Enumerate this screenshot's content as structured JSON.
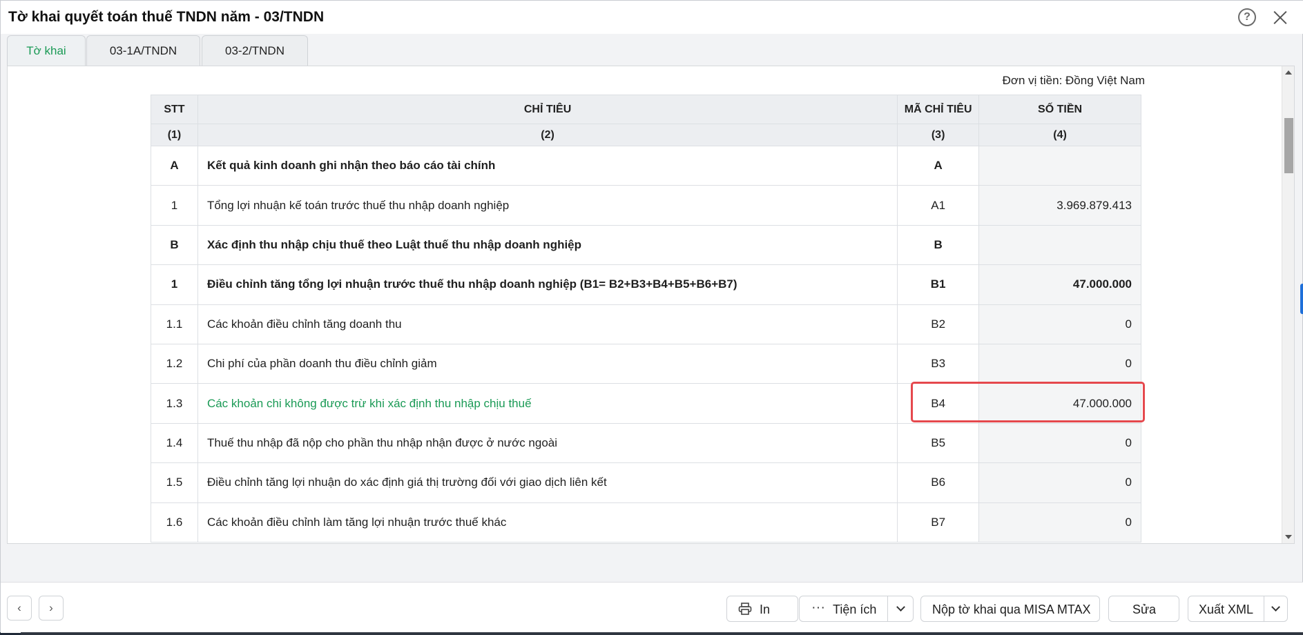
{
  "dialog": {
    "title": "Tờ khai quyết toán thuế TNDN năm - 03/TNDN",
    "help_glyph": "?"
  },
  "tabs": [
    {
      "label": "Tờ khai",
      "active": true
    },
    {
      "label": "03-1A/TNDN",
      "active": false
    },
    {
      "label": "03-2/TNDN",
      "active": false
    }
  ],
  "unit_label": "Đơn vị tiền: Đồng Việt Nam",
  "table": {
    "headers": [
      "STT",
      "CHỈ TIÊU",
      "MÃ CHỈ TIÊU",
      "SỐ TIỀN"
    ],
    "subheaders": [
      "(1)",
      "(2)",
      "(3)",
      "(4)"
    ],
    "rows": [
      {
        "stt": "A",
        "name": "Kết quả kinh doanh ghi nhận theo báo cáo tài chính",
        "code": "A",
        "amount": "",
        "bold": true
      },
      {
        "stt": "1",
        "name": "Tổng lợi nhuận kế toán trước thuế thu nhập doanh nghiệp",
        "code": "A1",
        "amount": "3.969.879.413"
      },
      {
        "stt": "B",
        "name": "Xác định thu nhập chịu thuế theo Luật thuế thu nhập doanh nghiệp",
        "code": "B",
        "amount": "",
        "bold": true
      },
      {
        "stt": "1",
        "name": "Điều chỉnh tăng tổng lợi nhuận trước thuế thu nhập doanh nghiệp  (B1= B2+B3+B4+B5+B6+B7)",
        "code": "B1",
        "amount": "47.000.000",
        "bold": true
      },
      {
        "stt": "1.1",
        "name": "Các khoản điều chỉnh tăng doanh thu",
        "code": "B2",
        "amount": "0"
      },
      {
        "stt": "1.2",
        "name": "Chi phí của phần doanh thu điều chỉnh giảm",
        "code": "B3",
        "amount": "0"
      },
      {
        "stt": "1.3",
        "name": "Các khoản chi không được trừ khi xác định thu nhập chịu thuế",
        "code": "B4",
        "amount": "47.000.000",
        "green": true
      },
      {
        "stt": "1.4",
        "name": "Thuế thu nhập đã nộp cho phần thu nhập nhận được ở nước ngoài",
        "code": "B5",
        "amount": "0"
      },
      {
        "stt": "1.5",
        "name": "Điều chỉnh tăng lợi nhuận do xác định giá thị trường đối với giao dịch liên kết",
        "code": "B6",
        "amount": "0"
      },
      {
        "stt": "1.6",
        "name": "Các khoản điều chỉnh làm tăng lợi nhuận trước thuế khác",
        "code": "B7",
        "amount": "0"
      }
    ]
  },
  "footer": {
    "prev_glyph": "‹",
    "next_glyph": "›",
    "print_label": "In",
    "utilities_label": "Tiện ích",
    "submit_label": "Nộp tờ khai qua MISA MTAX",
    "edit_label": "Sửa",
    "export_label": "Xuất XML"
  },
  "colors": {
    "accent_green": "#1a9a55",
    "highlight_red": "#e5484d"
  }
}
